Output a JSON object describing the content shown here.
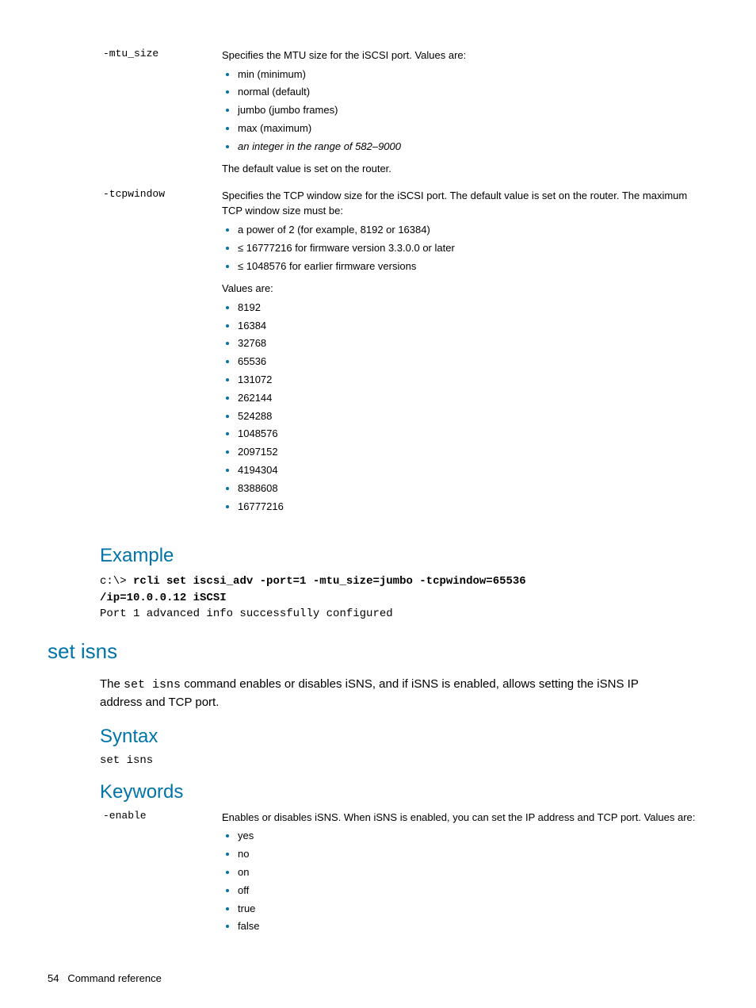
{
  "params1": [
    {
      "key": "-mtu_size",
      "intro": "Specifies the MTU size for the iSCSI port. Values are:",
      "bullets_plain": [
        "min (minimum)",
        "normal (default)",
        "jumbo (jumbo frames)",
        "max (maximum)"
      ],
      "bullets_italic": [
        "an integer in the range of 582–9000"
      ],
      "outro": "The default value is set on the router."
    },
    {
      "key": "-tcpwindow",
      "intro": "Specifies the TCP window size for the iSCSI port. The default value is set on the router. The maximum TCP window size must be:",
      "bullets_plain": [
        "a power of 2 (for example, 8192 or 16384)",
        "≤ 16777216 for firmware version 3.3.0.0 or later",
        "≤ 1048576 for earlier firmware versions"
      ],
      "mid": "Values are:",
      "bullets2": [
        "8192",
        "16384",
        "32768",
        "65536",
        "131072",
        "262144",
        "524288",
        "1048576",
        "2097152",
        "4194304",
        "8388608",
        "16777216"
      ]
    }
  ],
  "example_heading": "Example",
  "example_prompt": "c:\\> ",
  "example_cmd_line1": "rcli set iscsi_adv -port=1 -mtu_size=jumbo -tcpwindow=65536",
  "example_cmd_line2": "/ip=10.0.0.12 iSCSI",
  "example_output": "Port 1 advanced info successfully configured",
  "set_isns_heading": "set isns",
  "set_isns_body_pre": "The ",
  "set_isns_cmd": "set isns",
  "set_isns_body_post": " command enables or disables iSNS, and if iSNS is enabled, allows setting the iSNS IP address and TCP port.",
  "syntax_heading": "Syntax",
  "syntax_line": "set isns",
  "keywords_heading": "Keywords",
  "params2": [
    {
      "key": "-enable",
      "intro": "Enables or disables iSNS. When iSNS is enabled, you can set the IP address and TCP port. Values are:",
      "bullets_plain": [
        "yes",
        "no",
        "on",
        "off",
        "true",
        "false"
      ]
    }
  ],
  "footer_page": "54",
  "footer_text": "Command reference"
}
